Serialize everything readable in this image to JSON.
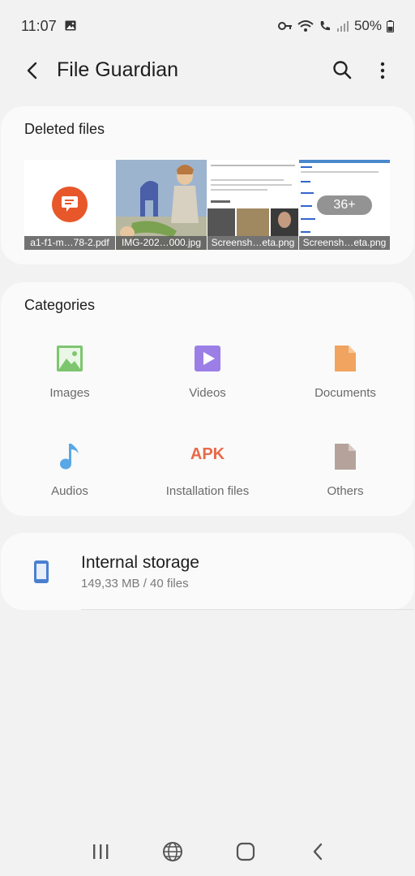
{
  "status": {
    "time": "11:07",
    "battery": "50%"
  },
  "appbar": {
    "title": "File Guardian"
  },
  "deleted": {
    "title": "Deleted files",
    "thumbs": [
      {
        "caption": "a1-f1-m…78-2.pdf"
      },
      {
        "caption": "IMG-202…000.jpg"
      },
      {
        "caption": "Screensh…eta.png"
      },
      {
        "caption": "Screensh…eta.png"
      }
    ],
    "more_count": "36+"
  },
  "categories": {
    "title": "Categories",
    "items": [
      {
        "label": "Images",
        "icon": "image-icon",
        "color": "#7dc66f"
      },
      {
        "label": "Videos",
        "icon": "video-icon",
        "color": "#9b7fe6"
      },
      {
        "label": "Documents",
        "icon": "document-icon",
        "color": "#f0a460"
      },
      {
        "label": "Audios",
        "icon": "music-note-icon",
        "color": "#5aa7e6"
      },
      {
        "label": "Installation files",
        "icon": "apk-icon",
        "color": "#e66a48",
        "icon_text": "APK"
      },
      {
        "label": "Others",
        "icon": "file-icon",
        "color": "#b5a39b"
      }
    ]
  },
  "storage": {
    "title": "Internal storage",
    "subtitle": "149,33 MB / 40 files",
    "color": "#4a7fd0"
  }
}
